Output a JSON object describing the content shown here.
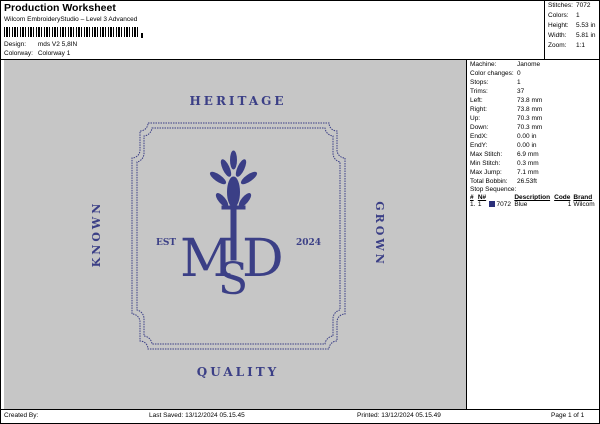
{
  "header": {
    "title": "Production Worksheet",
    "subtitle": "Wilcom EmbroideryStudio – Level 3 Advanced",
    "design_label": "Design:",
    "design_value": "mds V2 5,8IN",
    "colorway_label": "Colorway:",
    "colorway_value": "Colorway 1"
  },
  "stats": [
    {
      "label": "Stitches:",
      "value": "7072"
    },
    {
      "label": "Colors:",
      "value": "1"
    },
    {
      "label": "Height:",
      "value": "5.53 in"
    },
    {
      "label": "Width:",
      "value": "5.81 in"
    },
    {
      "label": "Zoom:",
      "value": "1:1"
    }
  ],
  "info": [
    {
      "label": "Machine:",
      "value": "Janome"
    },
    {
      "label": "Color changes:",
      "value": "0"
    },
    {
      "label": "Stops:",
      "value": "1"
    },
    {
      "label": "Trims:",
      "value": "37"
    },
    {
      "label": "Left:",
      "value": "73.8 mm"
    },
    {
      "label": "Right:",
      "value": "73.8 mm"
    },
    {
      "label": "Up:",
      "value": "70.3 mm"
    },
    {
      "label": "Down:",
      "value": "70.3 mm"
    },
    {
      "label": "EndX:",
      "value": "0.00 in"
    },
    {
      "label": "EndY:",
      "value": "0.00 in"
    },
    {
      "label": "Max Stitch:",
      "value": "6.9 mm"
    },
    {
      "label": "Min Stitch:",
      "value": "0.3 mm"
    },
    {
      "label": "Max Jump:",
      "value": "7.1 mm"
    },
    {
      "label": "Total Bobbin:",
      "value": "26.53ft"
    }
  ],
  "stop_sequence": {
    "title": "Stop Sequence:",
    "headers": [
      "#",
      "N#",
      "Description",
      "Code",
      "Brand"
    ],
    "rows": [
      {
        "idx": "1.",
        "n": "1",
        "stitches": "7072",
        "description": "Blue",
        "code": "1",
        "brand": "Wilcom",
        "color": "#2a2f7a"
      }
    ]
  },
  "design": {
    "thread_color": "#3b3f86",
    "background": "#c6c6c6",
    "text_top": "HERITAGE",
    "text_bottom": "QUALITY",
    "text_left": "KNOWN",
    "text_right": "GROWN",
    "est": "EST",
    "year": "2024",
    "mono_left": "M",
    "mono_center": "S",
    "mono_right": "D"
  },
  "footer": {
    "created_by": "Created By:",
    "last_saved": "Last Saved: 13/12/2024 05.15.45",
    "printed": "Printed: 13/12/2024 05.15.49",
    "page": "Page 1 of 1"
  }
}
